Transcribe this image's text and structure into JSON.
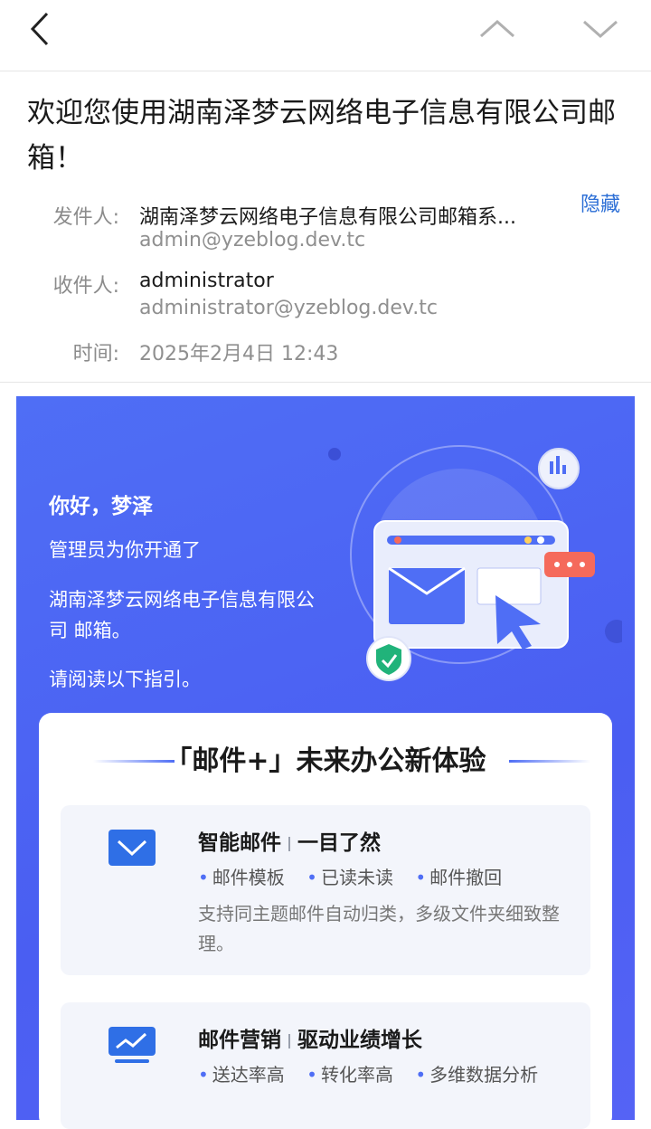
{
  "nav": {
    "back_icon": "chevron-left-icon",
    "prev_icon": "chevron-up-icon",
    "next_icon": "chevron-down-icon"
  },
  "subject": "欢迎您使用湖南泽梦云网络电子信息有限公司邮箱！",
  "meta": {
    "from_label": "发件人:",
    "from_name": "湖南泽梦云网络电子信息有限公司邮箱系...",
    "from_email": "admin@yzeblog.dev.tc",
    "hide_label": "隐藏",
    "to_label": "收件人:",
    "to_name": "administrator",
    "to_email": "administrator@yzeblog.dev.tc",
    "time_label": "时间:",
    "time_value": "2025年2月4日 12:43"
  },
  "body": {
    "greeting": "你好，梦泽",
    "line1": "管理员为你开通了",
    "line2": "湖南泽梦云网络电子信息有限公司 邮箱。",
    "line3": "请阅读以下指引。",
    "panel_title": "「邮件+」未来办公新体验",
    "features": [
      {
        "icon": "mail-check-icon",
        "title": "智能邮件",
        "subtitle": "一目了然",
        "tags": [
          "邮件模板",
          "已读未读",
          "邮件撤回"
        ],
        "desc": "支持同主题邮件自动归类，多级文件夹细致整理。"
      },
      {
        "icon": "trend-chart-icon",
        "title": "邮件营销",
        "subtitle": "驱动业绩增长",
        "tags": [
          "送达率高",
          "转化率高",
          "多维数据分析"
        ],
        "desc": ""
      }
    ]
  },
  "colors": {
    "accent": "#4f6ef5",
    "link": "#2d6fd6"
  }
}
